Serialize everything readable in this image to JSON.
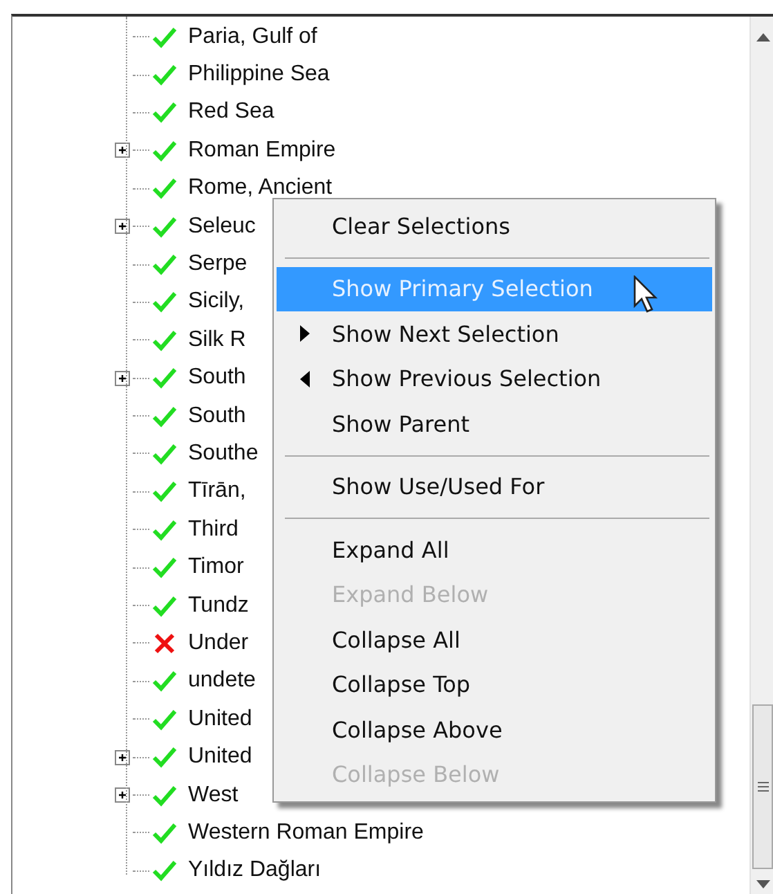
{
  "tree": {
    "items": [
      {
        "label": "Paria, Gulf of",
        "kind": "check",
        "expander": false
      },
      {
        "label": "Philippine Sea",
        "kind": "check",
        "expander": false
      },
      {
        "label": "Red Sea",
        "kind": "check",
        "expander": false
      },
      {
        "label": "Roman Empire",
        "kind": "check",
        "expander": true
      },
      {
        "label": "Rome, Ancient",
        "kind": "check",
        "expander": false
      },
      {
        "label": "Seleuc",
        "kind": "check",
        "expander": true
      },
      {
        "label": "Serpe",
        "kind": "check",
        "expander": false
      },
      {
        "label": "Sicily,",
        "kind": "check",
        "expander": false
      },
      {
        "label": "Silk R",
        "kind": "check",
        "expander": false
      },
      {
        "label": "South",
        "kind": "check",
        "expander": true
      },
      {
        "label": "South",
        "kind": "check",
        "expander": false
      },
      {
        "label": "Southe",
        "kind": "check",
        "expander": false
      },
      {
        "label": "Tīrān,",
        "kind": "check",
        "expander": false
      },
      {
        "label": "Third",
        "kind": "check",
        "expander": false
      },
      {
        "label": "Timor",
        "kind": "check",
        "expander": false
      },
      {
        "label": "Tundz",
        "kind": "check",
        "expander": false
      },
      {
        "label": "Under",
        "kind": "cross",
        "expander": false
      },
      {
        "label": "undete",
        "kind": "check",
        "expander": false
      },
      {
        "label": "United",
        "kind": "check",
        "expander": false
      },
      {
        "label": "United",
        "kind": "check",
        "expander": true
      },
      {
        "label": "West",
        "kind": "check",
        "expander": true
      },
      {
        "label": "Western Roman Empire",
        "kind": "check",
        "expander": false
      },
      {
        "label": "Yıldız Dağları",
        "kind": "check",
        "expander": false
      }
    ]
  },
  "context_menu": {
    "items": [
      {
        "kind": "item",
        "label": "Clear Selections",
        "disabled": false,
        "selected": false
      },
      {
        "kind": "separator"
      },
      {
        "kind": "item",
        "label": "Show Primary Selection",
        "disabled": false,
        "selected": true
      },
      {
        "kind": "forward",
        "label": "Show Next Selection",
        "disabled": false,
        "selected": false
      },
      {
        "kind": "backward",
        "label": "Show Previous Selection",
        "disabled": false,
        "selected": false
      },
      {
        "kind": "item",
        "label": "Show Parent",
        "disabled": false,
        "selected": false
      },
      {
        "kind": "separator"
      },
      {
        "kind": "item",
        "label": "Show Use/Used For",
        "disabled": false,
        "selected": false
      },
      {
        "kind": "separator"
      },
      {
        "kind": "item",
        "label": "Expand All",
        "disabled": false,
        "selected": false
      },
      {
        "kind": "item",
        "label": "Expand Below",
        "disabled": true,
        "selected": false
      },
      {
        "kind": "item",
        "label": "Collapse All",
        "disabled": false,
        "selected": false
      },
      {
        "kind": "item",
        "label": "Collapse Top",
        "disabled": false,
        "selected": false
      },
      {
        "kind": "item",
        "label": "Collapse Above",
        "disabled": false,
        "selected": false
      },
      {
        "kind": "item",
        "label": "Collapse Below",
        "disabled": true,
        "selected": false
      }
    ]
  }
}
